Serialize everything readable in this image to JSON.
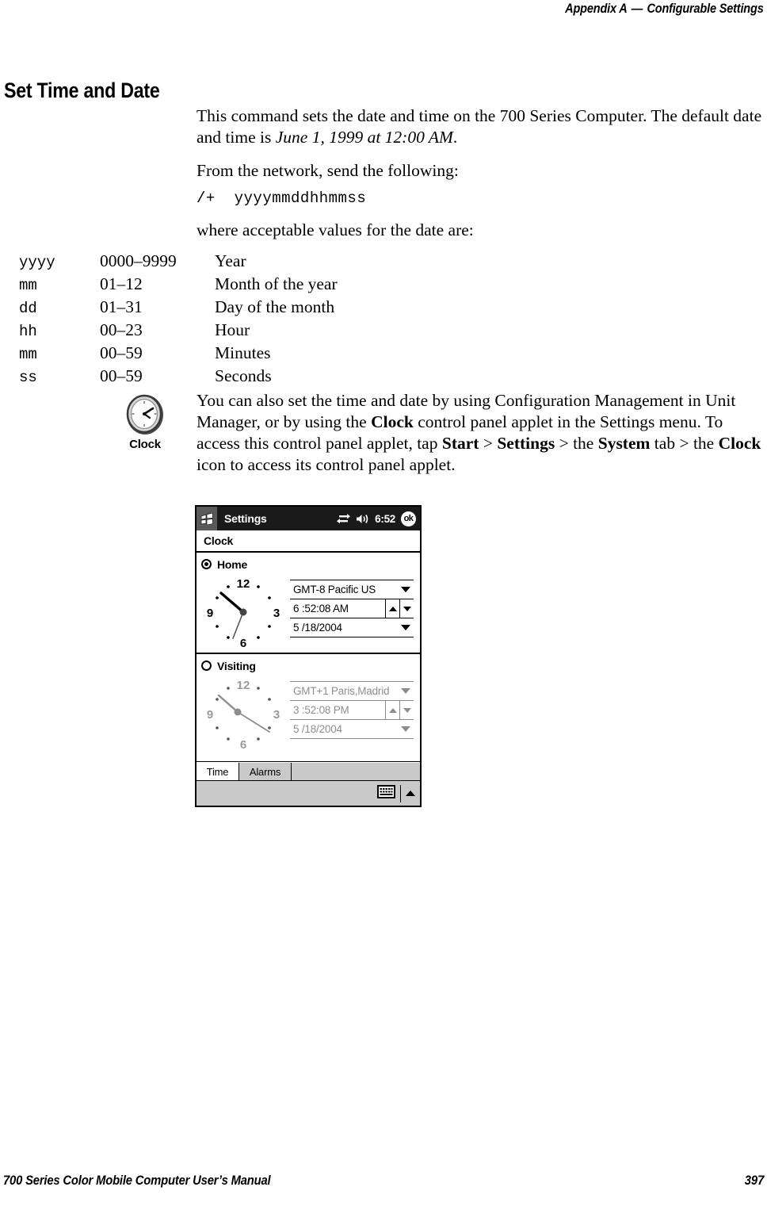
{
  "header": {
    "appendix": "Appendix A",
    "dash": "—",
    "title": "Configurable Settings"
  },
  "section": {
    "heading": "Set Time and Date",
    "paragraph1_a": "This command sets the date and time on the 700 Series Computer. The default date and time is ",
    "paragraph1_italic": "June 1, 1999 at 12:00 AM",
    "paragraph1_b": ".",
    "paragraph2": "From the network, send the following:",
    "code": "/+  yyyymmddhhmmss",
    "paragraph3": "where acceptable values for the date are:"
  },
  "value_table": {
    "rows": [
      {
        "token": "yyyy",
        "range": "0000–9999",
        "meaning": "Year"
      },
      {
        "token": "mm",
        "range": "01–12",
        "meaning": "Month of the year"
      },
      {
        "token": "dd",
        "range": "01–31",
        "meaning": "Day of the month"
      },
      {
        "token": "hh",
        "range": "00–23",
        "meaning": "Hour"
      },
      {
        "token": "mm",
        "range": "00–59",
        "meaning": "Minutes"
      },
      {
        "token": "ss",
        "range": "00–59",
        "meaning": "Seconds"
      }
    ]
  },
  "note": {
    "icon_label": "Clock",
    "t1": "You can also set the time and date by using Configuration Management in Unit Manager, or by using the ",
    "b1": "Clock",
    "t2": " control panel applet in the Settings menu. To access this control panel applet, tap ",
    "b2": "Start",
    "t3": " > ",
    "b3": "Settings",
    "t4": " > the ",
    "b4": "System",
    "t5": " tab > the ",
    "b5": "Clock",
    "t6": " icon to access its control panel applet."
  },
  "pda": {
    "title": "Settings",
    "tray_time": "6:52",
    "ok_label": "ok",
    "subtitle": "Clock",
    "home": {
      "radio_label": "Home",
      "timezone": "GMT-8 Pacific US",
      "time": "6 :52:08 AM",
      "date": "5 /18/2004",
      "clock_numbers": [
        "12",
        "3",
        "6",
        "9"
      ]
    },
    "visiting": {
      "radio_label": "Visiting",
      "timezone": "GMT+1 Paris,Madrid",
      "time": "3 :52:08 PM",
      "date": "5 /18/2004",
      "clock_numbers": [
        "12",
        "3",
        "6",
        "9"
      ]
    },
    "tabs": [
      {
        "label": "Time",
        "selected": true
      },
      {
        "label": "Alarms",
        "selected": false
      }
    ]
  },
  "footer": {
    "manual": "700 Series Color Mobile Computer User’s Manual",
    "page": "397"
  },
  "colors": {
    "ink": "#000000",
    "paper": "#ffffff",
    "titlebar": "#1a1a1a",
    "disabled": "#8e8e8e",
    "chrome_grey": "#c9c9c9"
  }
}
